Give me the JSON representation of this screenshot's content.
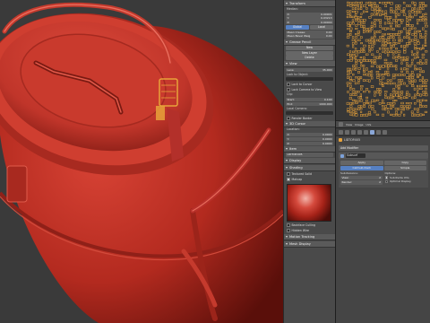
{
  "npanel": {
    "transform": {
      "header": "Transform",
      "median_label": "Median:",
      "median": [
        {
          "axis": "X:",
          "value": "0.00901"
        },
        {
          "axis": "Y:",
          "value": "0.03213"
        },
        {
          "axis": "Z:",
          "value": "0.00000"
        }
      ],
      "global_label": "Global",
      "local_label": "Local",
      "mean_crease_label": "Mean Crease:",
      "mean_crease": "0.00",
      "bevel_weight_label": "Mean Bevel Weig",
      "bevel_weight": "0.00"
    },
    "grease_pencil": {
      "header": "Grease Pencil",
      "new_label": "New",
      "new_layer_label": "New Layer",
      "delete_label": "Delete"
    },
    "view": {
      "header": "View",
      "lens_label": "Lens:",
      "lens": "35.000",
      "lock_object_label": "Lock to Object:",
      "lock_cursor_label": "Lock to Cursor",
      "lock_camera_label": "Lock Camera to View",
      "clip_label": "Clip:",
      "start_label": "Start:",
      "start": "0.100",
      "end_label": "End:",
      "end": "1000.000",
      "local_camera_label": "Local Camera:",
      "render_border_label": "Render Border"
    },
    "cursor": {
      "header": "3D Cursor",
      "location_label": "Location:",
      "loc": [
        {
          "axis": "X:",
          "value": "0.0000"
        },
        {
          "axis": "Y:",
          "value": "0.0000"
        },
        {
          "axis": "Z:",
          "value": "0.0000"
        }
      ]
    },
    "item": {
      "header": "Item",
      "name": "LIDTOP.005"
    },
    "display": {
      "header": "Display"
    },
    "shading": {
      "header": "Shading",
      "textured_solid_label": "Textured Solid",
      "matcap_label": "Matcap",
      "backface_label": "Backface Culling",
      "hidden_wire_label": "Hidden Wire"
    },
    "motion": {
      "header": "Motion Tracking"
    },
    "mesh_display": {
      "header": "Mesh Display"
    }
  },
  "image_toolbar": {
    "view": "View",
    "image": "Image",
    "uvs": "UVs"
  },
  "properties": {
    "object_name": "LIDTOP.005",
    "add_modifier": "Add Modifier",
    "modifier": {
      "name": "Subsurf",
      "apply": "Apply",
      "copy": "Copy",
      "catmull": "Catmull-Clark",
      "simple": "Simple",
      "subdivisions_label": "Subdivisions:",
      "view_label": "View:",
      "view": "2",
      "render_label": "Render:",
      "render": "2",
      "options_label": "Options:",
      "subdivide_uvs": "Subdivide UVs",
      "optimal_display": "Optimal Display"
    }
  },
  "colors": {
    "object_red": "#c8362a",
    "selection_orange": "#e8a23a",
    "accent_blue": "#5680c2"
  }
}
